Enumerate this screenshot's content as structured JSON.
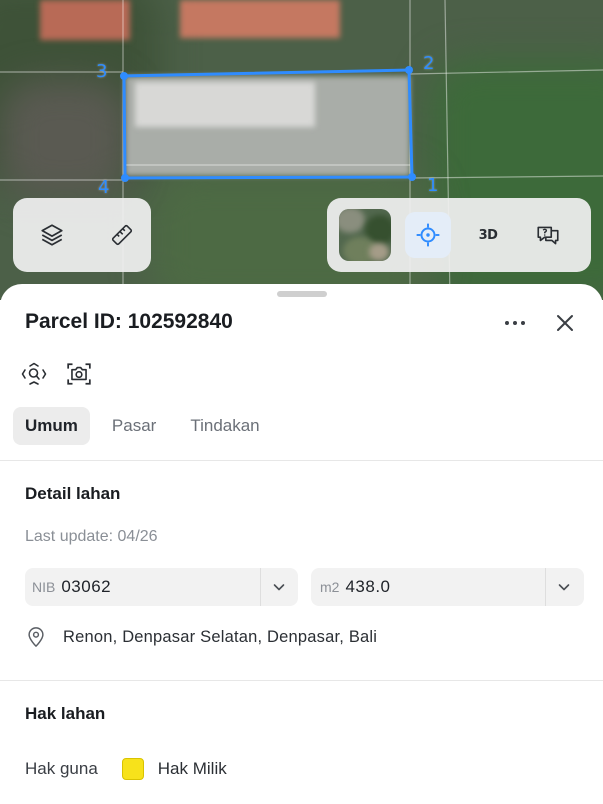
{
  "map": {
    "vertex_labels": [
      "1",
      "2",
      "3",
      "4"
    ],
    "toolbar_left": {
      "icons": [
        "layers-icon",
        "ruler-icon"
      ]
    },
    "toolbar_right": {
      "three_d_label": "3D",
      "icons": [
        "satellite-thumbnail",
        "locate-icon",
        "chat-icon"
      ]
    }
  },
  "sheet": {
    "title": "Parcel ID: 102592840",
    "tabs": [
      {
        "label": "Umum",
        "active": true
      },
      {
        "label": "Pasar",
        "active": false
      },
      {
        "label": "Tindakan",
        "active": false
      }
    ],
    "detail": {
      "heading": "Detail lahan",
      "last_update": "Last update: 04/26",
      "nib_label": "NIB",
      "nib_value": "03062",
      "area_label": "m2",
      "area_value": "438.0",
      "location": "Renon, Denpasar Selatan, Denpasar, Bali"
    },
    "rights": {
      "heading": "Hak lahan",
      "label": "Hak guna",
      "value": "Hak Milik",
      "swatch_color": "#f7e21b"
    }
  },
  "colors": {
    "parcel_outline": "#2f8cff",
    "accent": "#2f8cff"
  }
}
